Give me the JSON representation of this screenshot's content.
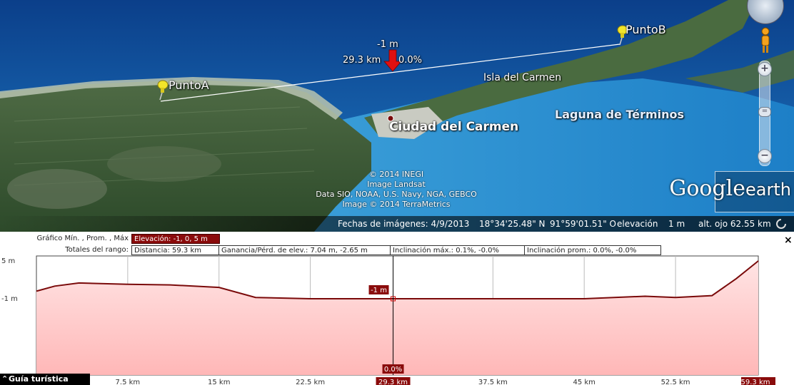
{
  "map": {
    "pins": [
      {
        "label": "PuntoA"
      },
      {
        "label": "PuntoB"
      }
    ],
    "places": {
      "city": "Ciudad del Carmen",
      "island": "Isla del Carmen",
      "lagoon": "Laguna de Términos"
    },
    "measurement": {
      "elevation": "-1 m",
      "distance": "29.3 km",
      "slope": "0.0%"
    },
    "attribution": [
      "© 2014 INEGI",
      "Image Landsat",
      "Data SIO, NOAA, U.S. Navy, NGA, GEBCO",
      "Image © 2014 TerraMetrics"
    ],
    "logo": {
      "brand": "Google",
      "product": "earth"
    },
    "zoom": {
      "in": "+",
      "out": "−",
      "slider": "="
    }
  },
  "statusbar": {
    "imagery_date": "Fechas de imágenes: 4/9/2013",
    "lat": "18°34'25.48\" N",
    "lon": "91°59'01.51\" O",
    "elev_label": "elevación",
    "elev_value": "1 m",
    "eye_alt": "alt. ojo  62.55 km"
  },
  "profile": {
    "row1": {
      "label": "Gráfico  Mín. , Prom. , Máx",
      "elevation": "Elevación: -1, 0, 5 m"
    },
    "row2": {
      "label": "Totales del rango:",
      "distance": "Distancia: 59.3 km",
      "gain": "Ganancia/Pérd. de elev.: 7.04 m, -2.65 m",
      "max_slope": "Inclinación máx.: 0.1%, -0.0%",
      "avg_slope": "Inclinación prom.: 0.0%, -0.0%"
    },
    "close": "×",
    "tour_button": "Guía turística"
  },
  "chart_data": {
    "type": "area",
    "title": "",
    "xlabel": "",
    "ylabel": "",
    "x_unit": "km",
    "y_unit": "m",
    "xlim": [
      0,
      59.3
    ],
    "ylim": [
      -1,
      5
    ],
    "y_ticks": [
      "5 m",
      "-1 m"
    ],
    "x_ticks": [
      {
        "value": 7.5,
        "label": "7.5 km"
      },
      {
        "value": 15,
        "label": "15 km"
      },
      {
        "value": 22.5,
        "label": "22.5 km"
      },
      {
        "value": 29.3,
        "label": "29.3 km"
      },
      {
        "value": 37.5,
        "label": "37.5 km"
      },
      {
        "value": 45,
        "label": "45 km"
      },
      {
        "value": 52.5,
        "label": "52.5 km"
      },
      {
        "value": 59.3,
        "label": "59.3 km"
      }
    ],
    "grid": true,
    "series": [
      {
        "x": [
          0,
          1.5,
          3.5,
          7.5,
          11,
          15,
          18,
          22.5,
          29.3,
          37.5,
          45,
          50,
          52.5,
          55.5,
          57.5,
          59.3
        ],
        "y": [
          0.2,
          1.0,
          1.5,
          1.3,
          1.2,
          0.8,
          -0.8,
          -1,
          -1,
          -1,
          -1,
          -0.6,
          -0.8,
          -0.5,
          2.2,
          5.0
        ]
      }
    ],
    "cursor": {
      "x": 29.3,
      "elevation_label": "-1 m",
      "slope_label": "0.0%",
      "distance_label": "29.3 km"
    }
  }
}
